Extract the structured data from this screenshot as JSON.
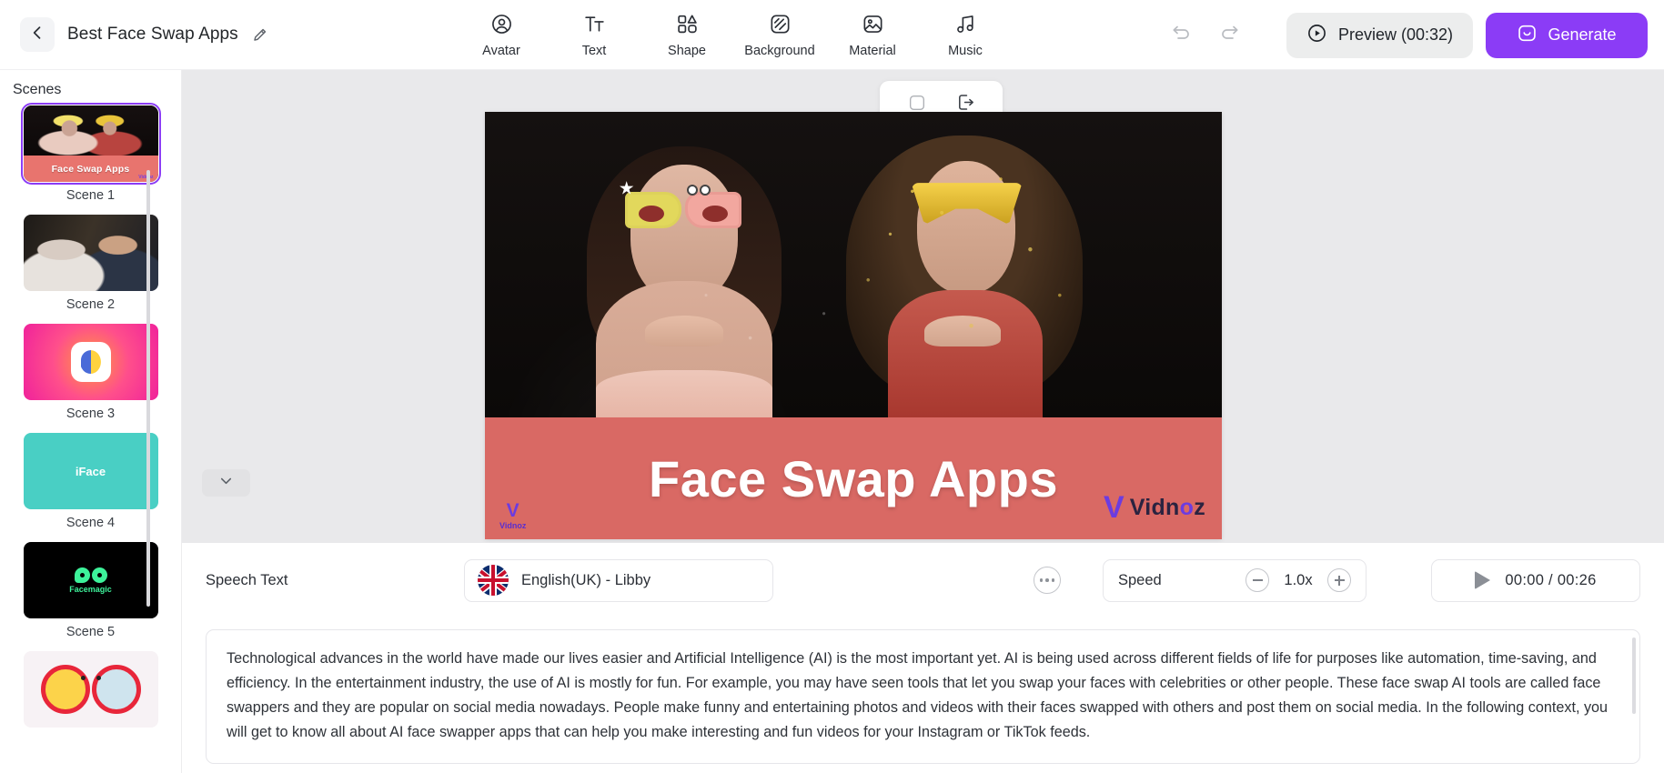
{
  "header": {
    "back_icon": "chevron-left-icon",
    "project_title": "Best Face Swap Apps",
    "edit_icon": "pencil-icon",
    "tools": [
      {
        "label": "Avatar",
        "icon": "avatar-icon"
      },
      {
        "label": "Text",
        "icon": "text-icon"
      },
      {
        "label": "Shape",
        "icon": "shape-icon"
      },
      {
        "label": "Background",
        "icon": "background-icon"
      },
      {
        "label": "Material",
        "icon": "material-icon"
      },
      {
        "label": "Music",
        "icon": "music-icon"
      }
    ],
    "undo_icon": "undo-icon",
    "redo_icon": "redo-icon",
    "preview_label": "Preview (00:32)",
    "preview_icon": "play-circle-icon",
    "generate_label": "Generate",
    "generate_icon": "sparkle-smile-icon",
    "generate_color": "#8b3cf6"
  },
  "sidebar": {
    "title": "Scenes",
    "scenes": [
      {
        "label": "Scene 1",
        "selected": true,
        "thumb_title": "Face Swap Apps",
        "watermark": "Vidnoz"
      },
      {
        "label": "Scene 2",
        "selected": false
      },
      {
        "label": "Scene 3",
        "selected": false
      },
      {
        "label": "Scene 4",
        "selected": false,
        "thumb_title": "iFace"
      },
      {
        "label": "Scene 5",
        "selected": false,
        "thumb_title": "Facemagic"
      },
      {
        "label": "",
        "selected": false
      }
    ]
  },
  "canvas": {
    "toolbar": {
      "crop_icon": "rounded-square-icon",
      "export_icon": "export-out-icon"
    },
    "video": {
      "title": "Face Swap Apps",
      "watermark_small": "Vidnoz",
      "watermark_large": "Vidnoz",
      "band_color": "#ea726c"
    },
    "collapse_icon": "chevron-down-icon"
  },
  "bottom_panel": {
    "speech_label": "Speech Text",
    "voice": {
      "name": "English(UK) - Libby",
      "flag": "uk-flag-icon",
      "more_icon": "more-dots-icon"
    },
    "speed": {
      "label": "Speed",
      "value": "1.0x",
      "minus_icon": "minus-circle-icon",
      "plus_icon": "plus-circle-icon"
    },
    "player": {
      "play_icon": "play-icon",
      "time": "00:00 / 00:26"
    },
    "speech_text": "Technological advances in the world have made our lives easier and Artificial Intelligence (AI) is the most important yet. AI is being used across different fields of life for purposes like automation, time-saving, and efficiency. In the entertainment industry, the use of AI is mostly for fun. For example, you may have seen tools that let you swap your faces with celebrities or other people. These face swap AI tools are called face swappers and they are popular on social media nowadays. People make funny and entertaining photos and videos with their faces swapped with others and post them on social media. In the following context, you will get to know all about AI face swapper apps that can help you make interesting and fun videos for your Instagram or TikTok feeds."
  }
}
